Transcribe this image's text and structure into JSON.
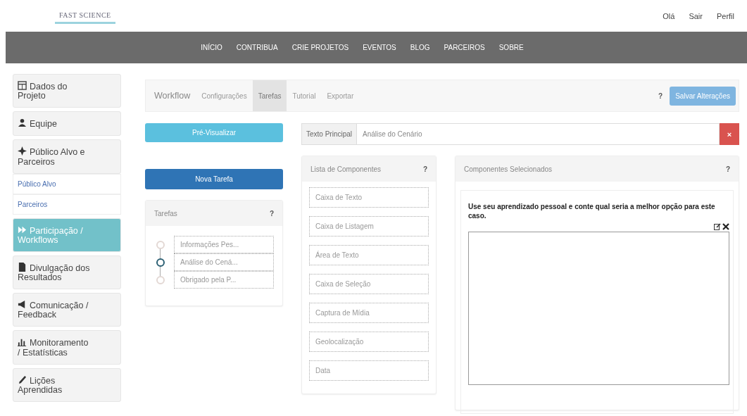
{
  "header": {
    "logo": "FAST SCIENCE",
    "user_links": [
      "Olá",
      "Sair",
      "Perfil"
    ]
  },
  "nav": {
    "items": [
      "INÍCIO",
      "CONTRIBUA",
      "CRIE PROJETOS",
      "EVENTOS",
      "BLOG",
      "PARCEIROS",
      "SOBRE"
    ]
  },
  "sidebar": {
    "items": [
      {
        "label": "Dados do Projeto",
        "selected": false
      },
      {
        "label": "Equipe",
        "selected": false
      },
      {
        "label": "Público Alvo e Parceiros",
        "selected": false,
        "children": [
          {
            "label": "Público Alvo"
          },
          {
            "label": "Parceiros"
          }
        ]
      },
      {
        "label": "Participação / Workflows",
        "selected": true
      },
      {
        "label": "Divulgação dos Resultados",
        "selected": false
      },
      {
        "label": "Comunicação / Feedback",
        "selected": false
      },
      {
        "label": "Monitoramento / Estatísticas",
        "selected": false
      },
      {
        "label": "Lições Aprendidas",
        "selected": false
      }
    ]
  },
  "tabs": [
    {
      "label": "Workflow",
      "selected": false
    },
    {
      "label": "Configurações",
      "selected": false
    },
    {
      "label": "Tarefas",
      "selected": true
    },
    {
      "label": "Tutorial",
      "selected": false
    },
    {
      "label": "Exportar",
      "selected": false
    }
  ],
  "help_mark": "?",
  "save_button": "Salvar Alterações",
  "preview_button": "Pré-Visualizar",
  "new_task_button": "Nova Tarefa",
  "tasks_panel": {
    "title": "Tarefas",
    "help": "?",
    "items": [
      {
        "label": "Informações Pes...",
        "selected": false
      },
      {
        "label": "Análise do Cená...",
        "selected": true
      },
      {
        "label": "Obrigado pela P...",
        "selected": false
      }
    ]
  },
  "main_text": {
    "label": "Texto Principal",
    "value": "Análise do Cenário",
    "remove": "×"
  },
  "components_panel": {
    "title": "Lista de Componentes",
    "help": "?",
    "items": [
      "Caixa de Texto",
      "Caixa de Listagem",
      "Área de Texto",
      "Caixa de Seleção",
      "Captura de Mídia",
      "Geolocalização",
      "Data"
    ]
  },
  "selected_panel": {
    "title": "Componentes Selecionados",
    "help": "?",
    "question": "Use seu aprendizado pessoal e conte qual seria a melhor opção para este caso."
  }
}
